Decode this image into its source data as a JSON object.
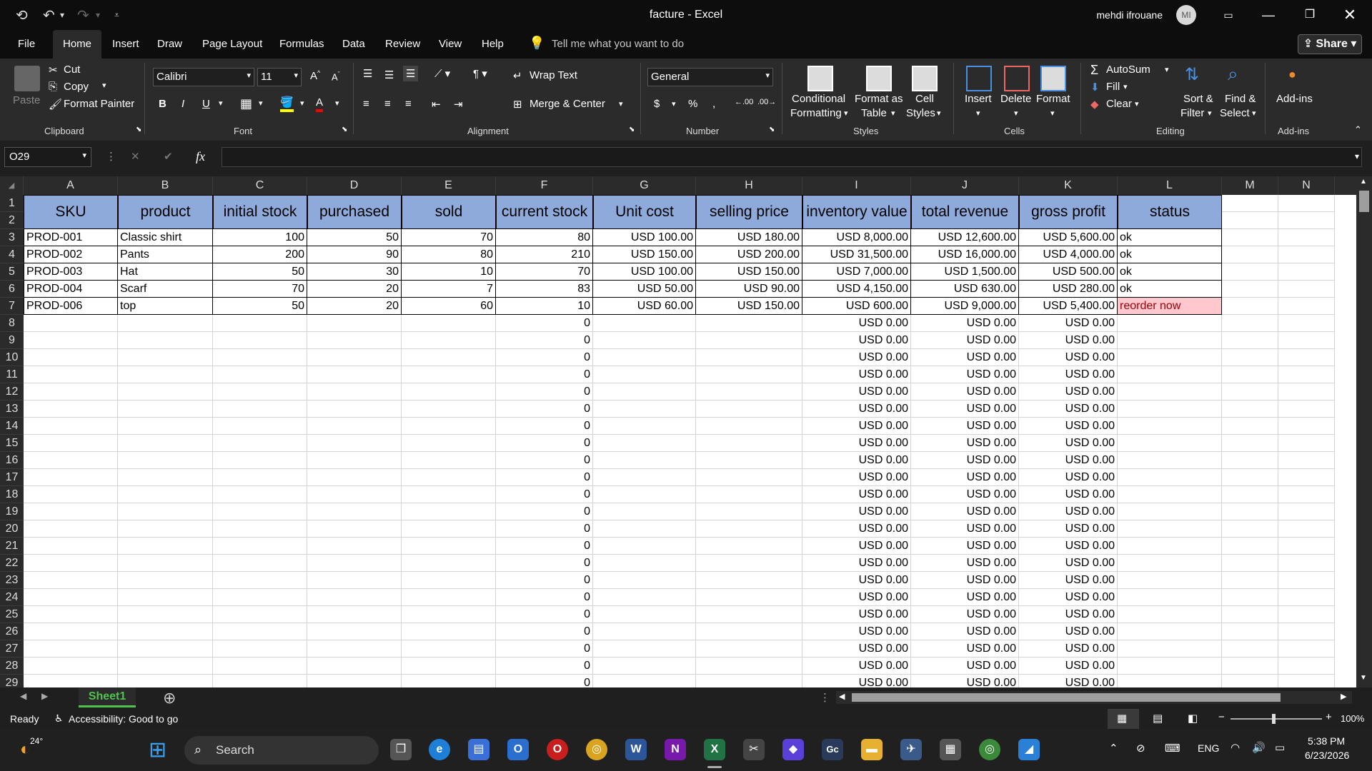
{
  "window": {
    "title": "facture  -  Excel",
    "user_name": "mehdi ifrouane",
    "user_initials": "MI"
  },
  "menu": {
    "items": [
      "File",
      "Home",
      "Insert",
      "Draw",
      "Page Layout",
      "Formulas",
      "Data",
      "Review",
      "View",
      "Help"
    ],
    "active": "Home",
    "tell_me": "Tell me what you want to do",
    "share": "Share"
  },
  "ribbon": {
    "clipboard": {
      "paste": "Paste",
      "cut": "Cut",
      "copy": "Copy",
      "format_painter": "Format Painter",
      "label": "Clipboard"
    },
    "font": {
      "name": "Calibri",
      "size": "11",
      "label": "Font"
    },
    "alignment": {
      "wrap_text": "Wrap Text",
      "merge_center": "Merge & Center",
      "label": "Alignment"
    },
    "number": {
      "format": "General",
      "label": "Number"
    },
    "styles": {
      "conditional_1": "Conditional",
      "conditional_2": "Formatting",
      "format_table_1": "Format as",
      "format_table_2": "Table",
      "cell_styles_1": "Cell",
      "cell_styles_2": "Styles",
      "label": "Styles"
    },
    "cells": {
      "insert": "Insert",
      "delete": "Delete",
      "format": "Format",
      "label": "Cells"
    },
    "editing": {
      "autosum": "AutoSum",
      "fill": "Fill",
      "clear": "Clear",
      "sort_1": "Sort &",
      "sort_2": "Filter",
      "find_1": "Find &",
      "find_2": "Select",
      "label": "Editing"
    },
    "addins": {
      "addins": "Add-ins",
      "label": "Add-ins"
    }
  },
  "formula_bar": {
    "name_box": "O29",
    "fx": "fx",
    "value": ""
  },
  "columns": [
    "A",
    "B",
    "C",
    "D",
    "E",
    "F",
    "G",
    "H",
    "I",
    "J",
    "K",
    "L",
    "M",
    "N"
  ],
  "headers": [
    "SKU",
    "product",
    "initial stock",
    "purchased",
    "sold",
    "current stock",
    "Unit cost",
    "selling price",
    "inventory value",
    "total revenue",
    "gross profit",
    "status"
  ],
  "rows": [
    [
      "PROD-001",
      "Classic shirt",
      "100",
      "50",
      "70",
      "80",
      "USD 100.00",
      "USD 180.00",
      "USD 8,000.00",
      "USD 12,600.00",
      "USD 5,600.00",
      "ok"
    ],
    [
      "PROD-002",
      "Pants",
      "200",
      "90",
      "80",
      "210",
      "USD 150.00",
      "USD 200.00",
      "USD 31,500.00",
      "USD 16,000.00",
      "USD 4,000.00",
      "ok"
    ],
    [
      "PROD-003",
      "Hat",
      "50",
      "30",
      "10",
      "70",
      "USD 100.00",
      "USD 150.00",
      "USD 7,000.00",
      "USD 1,500.00",
      "USD 500.00",
      "ok"
    ],
    [
      "PROD-004",
      "Scarf",
      "70",
      "20",
      "7",
      "83",
      "USD 50.00",
      "USD 90.00",
      "USD 4,150.00",
      "USD 630.00",
      "USD 280.00",
      "ok"
    ],
    [
      "PROD-006",
      "top",
      "50",
      "20",
      "60",
      "10",
      "USD 60.00",
      "USD 150.00",
      "USD 600.00",
      "USD 9,000.00",
      "USD 5,400.00",
      "reorder now"
    ]
  ],
  "empty_row_values": {
    "current_stock": "0",
    "inventory_value": "USD 0.00",
    "total_revenue": "USD 0.00",
    "gross_profit": "USD 0.00"
  },
  "row_numbers": [
    "1",
    "2",
    "3",
    "4",
    "5",
    "6",
    "7",
    "8",
    "9",
    "10",
    "11",
    "12",
    "13",
    "14",
    "15",
    "16",
    "17",
    "18",
    "19",
    "20",
    "21",
    "22",
    "23",
    "24",
    "25",
    "26",
    "27",
    "28",
    "29"
  ],
  "sheet": {
    "name": "Sheet1"
  },
  "status": {
    "ready": "Ready",
    "accessibility": "Accessibility: Good to go",
    "zoom": "100%"
  },
  "taskbar": {
    "weather": "24°",
    "search": "Search",
    "lang": "ENG",
    "time": "5:38 PM",
    "date": "6/23/2026"
  },
  "colors": {
    "header_fill": "#8eaadb",
    "reorder_fill": "#ffc7ce",
    "reorder_text": "#9c0006",
    "accent_green": "#4ec44e"
  }
}
